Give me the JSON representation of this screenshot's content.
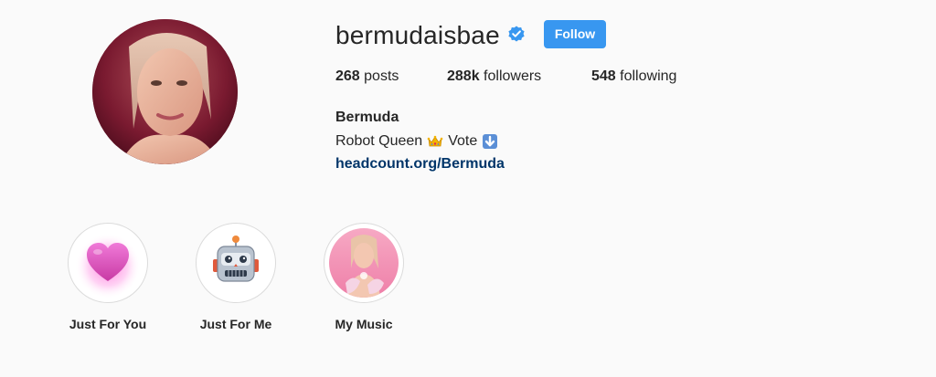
{
  "profile": {
    "username": "bermudaisbae",
    "verified": true,
    "follow_label": "Follow",
    "full_name": "Bermuda",
    "bio_before": "Robot Queen",
    "bio_middle": "Vote",
    "bio_emojis": [
      "crown-emoji",
      "down-arrow-emoji"
    ],
    "link": "headcount.org/Bermuda"
  },
  "stats": {
    "posts_count": "268",
    "posts_label": "posts",
    "followers_count": "288k",
    "followers_label": "followers",
    "following_count": "548",
    "following_label": "following"
  },
  "highlights": [
    {
      "label": "Just For You",
      "icon": "pink-heart-icon"
    },
    {
      "label": "Just For Me",
      "icon": "robot-face-icon"
    },
    {
      "label": "My Music",
      "icon": "photo-thumbnail"
    }
  ],
  "colors": {
    "background": "#fafafa",
    "text": "#262626",
    "follow_button": "#3897f0",
    "link": "#003569",
    "verified_badge": "#3897f0",
    "highlight_border": "#dbdbdb"
  }
}
